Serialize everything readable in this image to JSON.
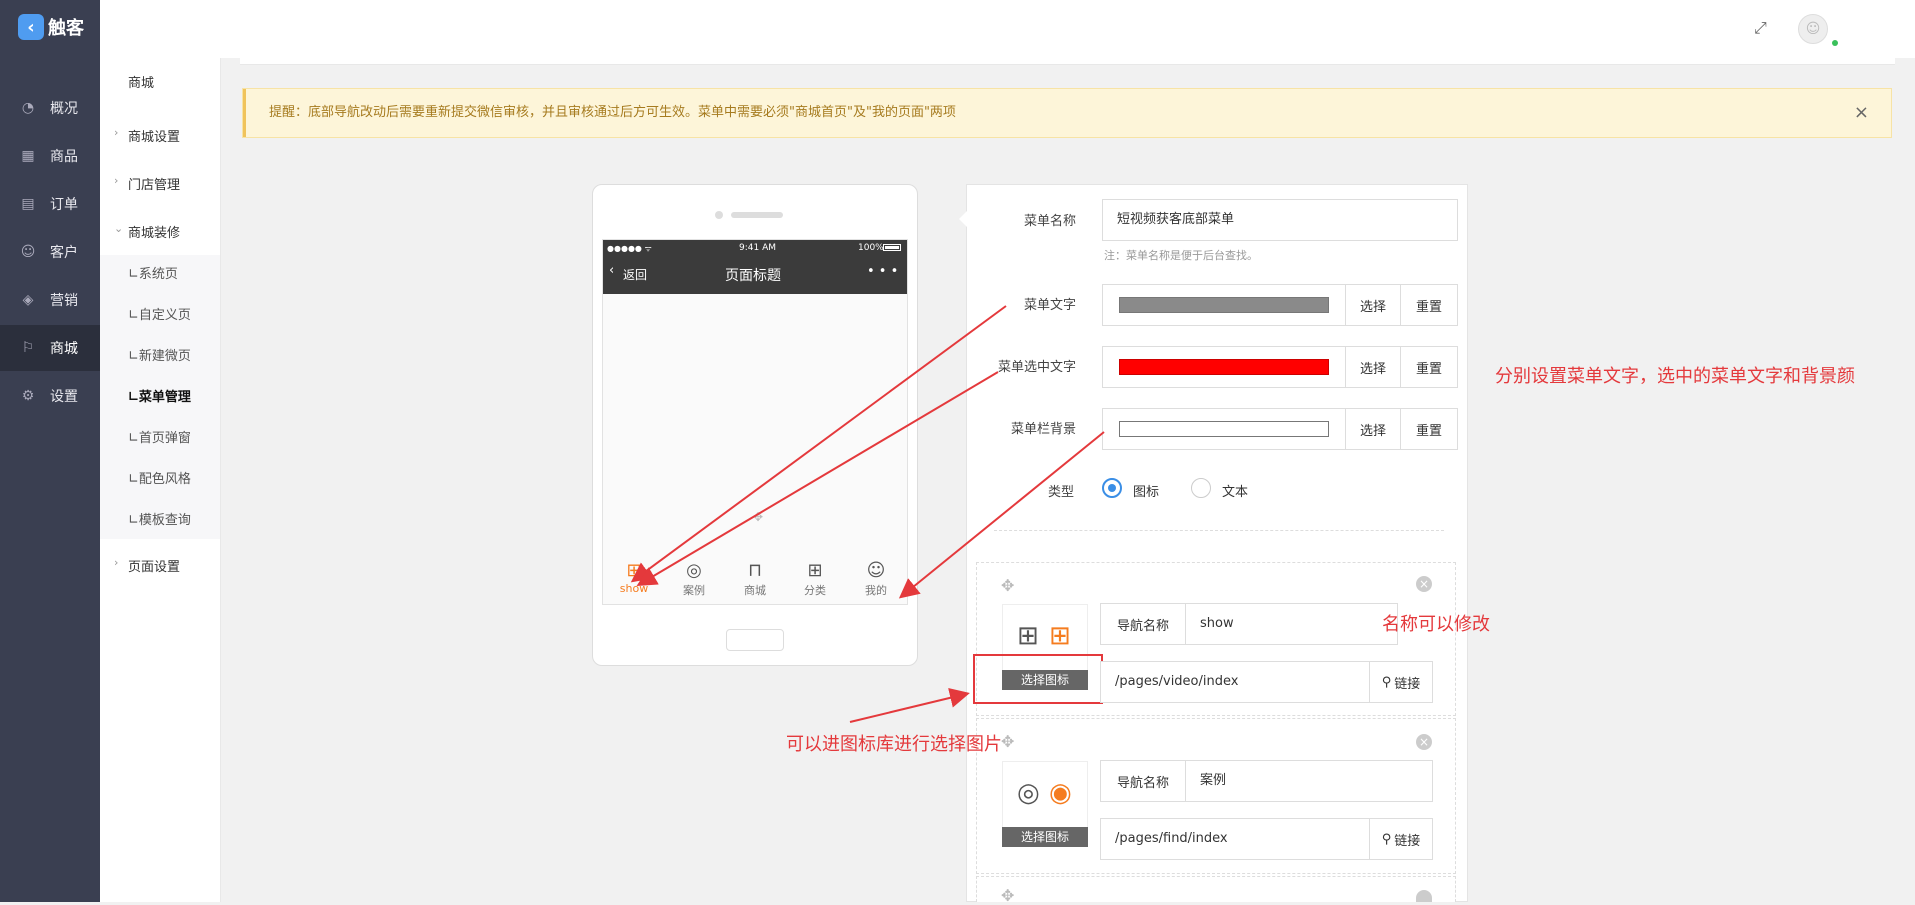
{
  "app": {
    "logo": "触客"
  },
  "nav": [
    {
      "icon": "dashboard-icon",
      "glyph": "◔",
      "label": "概况"
    },
    {
      "icon": "grid-icon",
      "glyph": "▦",
      "label": "商品"
    },
    {
      "icon": "calendar-icon",
      "glyph": "▤",
      "label": "订单"
    },
    {
      "icon": "user-icon",
      "glyph": "☺",
      "label": "客户"
    },
    {
      "icon": "tag-icon",
      "glyph": "◈",
      "label": "营销"
    },
    {
      "icon": "signpost-icon",
      "glyph": "⚐",
      "label": "商城"
    },
    {
      "icon": "gear-icon",
      "glyph": "⚙",
      "label": "设置"
    }
  ],
  "sub": {
    "title": "商城",
    "groups": [
      "商城设置",
      "门店管理",
      "商城装修",
      "页面设置"
    ],
    "children": [
      "∟系统页",
      "∟自定义页",
      "∟新建微页",
      "∟菜单管理",
      "∟首页弹窗",
      "∟配色风格",
      "∟模板查询"
    ]
  },
  "notice": {
    "text": "提醒：底部导航改动后需要重新提交微信审核，并且审核通过后方可生效。菜单中需要必须\"商城首页\"及\"我的页面\"两项"
  },
  "phone": {
    "status_left": "●●●●● ᯤ",
    "time": "9:41 AM",
    "battery": "100%",
    "back": "返回",
    "title": "页面标题",
    "more": "• • •",
    "tabs": [
      "show",
      "案例",
      "商城",
      "分类",
      "我的"
    ]
  },
  "form": {
    "menu_name_label": "菜单名称",
    "menu_name_value": "短视频获客底部菜单",
    "menu_name_hint": "注：菜单名称是便于后台查找。",
    "text_color_label": "菜单文字",
    "selected_color_label": "菜单选中文字",
    "bg_color_label": "菜单栏背景",
    "choose": "选择",
    "reset": "重置",
    "type_label": "类型",
    "type_icon": "图标",
    "type_text": "文本",
    "colors": {
      "text": "#8a8a8a",
      "selected": "#ff0000",
      "bg": "#ffffff",
      "accent": "#3a8ee6"
    }
  },
  "items": [
    {
      "nav_label": "导航名称",
      "name": "show",
      "path": "/pages/video/index",
      "choose_icon": "选择图标",
      "link": "链接"
    },
    {
      "nav_label": "导航名称",
      "name": "案例",
      "path": "/pages/find/index",
      "choose_icon": "选择图标",
      "link": "链接"
    }
  ],
  "annotations": {
    "a1": "分别设置菜单文字，选中的菜单文字和背景颜",
    "a2": "名称可以修改",
    "a3": "可以进图标库进行选择图片"
  }
}
